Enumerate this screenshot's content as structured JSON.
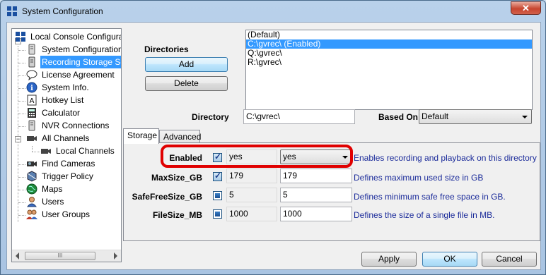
{
  "window": {
    "title": "System Configuration",
    "close_label": "✕"
  },
  "tree": {
    "items": [
      {
        "label": "Local Console Configurati",
        "icon": "grid-icon"
      },
      {
        "label": "System Configuration",
        "icon": "server-icon"
      },
      {
        "label": "Recording Storage Se",
        "icon": "storage-icon"
      },
      {
        "label": "License Agreement",
        "icon": "speech-icon"
      },
      {
        "label": "System Info.",
        "icon": "info-icon"
      },
      {
        "label": "Hotkey List",
        "icon": "keyboard-icon"
      },
      {
        "label": "Calculator",
        "icon": "calculator-icon"
      },
      {
        "label": "NVR Connections",
        "icon": "server-icon"
      },
      {
        "label": "All Channels",
        "icon": "camera-icon"
      },
      {
        "label": "Local Channels",
        "icon": "camera-icon"
      },
      {
        "label": "Find Cameras",
        "icon": "camera-find-icon"
      },
      {
        "label": "Trigger Policy",
        "icon": "trigger-icon"
      },
      {
        "label": "Maps",
        "icon": "globe-icon"
      },
      {
        "label": "Users",
        "icon": "user-icon"
      },
      {
        "label": "User Groups",
        "icon": "user-group-icon"
      }
    ],
    "scroll_grip": "III"
  },
  "directories": {
    "heading": "Directories",
    "add_label": "Add",
    "delete_label": "Delete",
    "list": [
      "(Default)",
      "C:\\gvrec\\ (Enabled)",
      "Q:\\gvrec\\",
      "R:\\gvrec\\"
    ],
    "selected_index": 1,
    "directory_label": "Directory",
    "directory_value": "C:\\gvrec\\",
    "based_on_label": "Based On",
    "based_on_value": "Default"
  },
  "tabs": {
    "storage": "Storage",
    "advanced": "Advanced"
  },
  "properties": [
    {
      "name": "Enabled",
      "checkbox": "checked",
      "default_value": "yes",
      "value": "yes",
      "is_combo": true,
      "description": "Enables recording and playback on this directory"
    },
    {
      "name": "MaxSize_GB",
      "checkbox": "checked",
      "default_value": "179",
      "value": "179",
      "is_combo": false,
      "description": "Defines maximum used size in GB"
    },
    {
      "name": "SafeFreeSize_GB",
      "checkbox": "square",
      "default_value": "5",
      "value": "5",
      "is_combo": false,
      "description": "Defines minimum safe free space in GB."
    },
    {
      "name": "FileSize_MB",
      "checkbox": "square",
      "default_value": "1000",
      "value": "1000",
      "is_combo": false,
      "description": "Defines the size of a single file in MB."
    }
  ],
  "footer": {
    "apply_label": "Apply",
    "ok_label": "OK",
    "cancel_label": "Cancel"
  },
  "colors": {
    "selection": "#3399ff",
    "highlight_ring": "#e00000",
    "description_text": "#1b2b9a"
  }
}
